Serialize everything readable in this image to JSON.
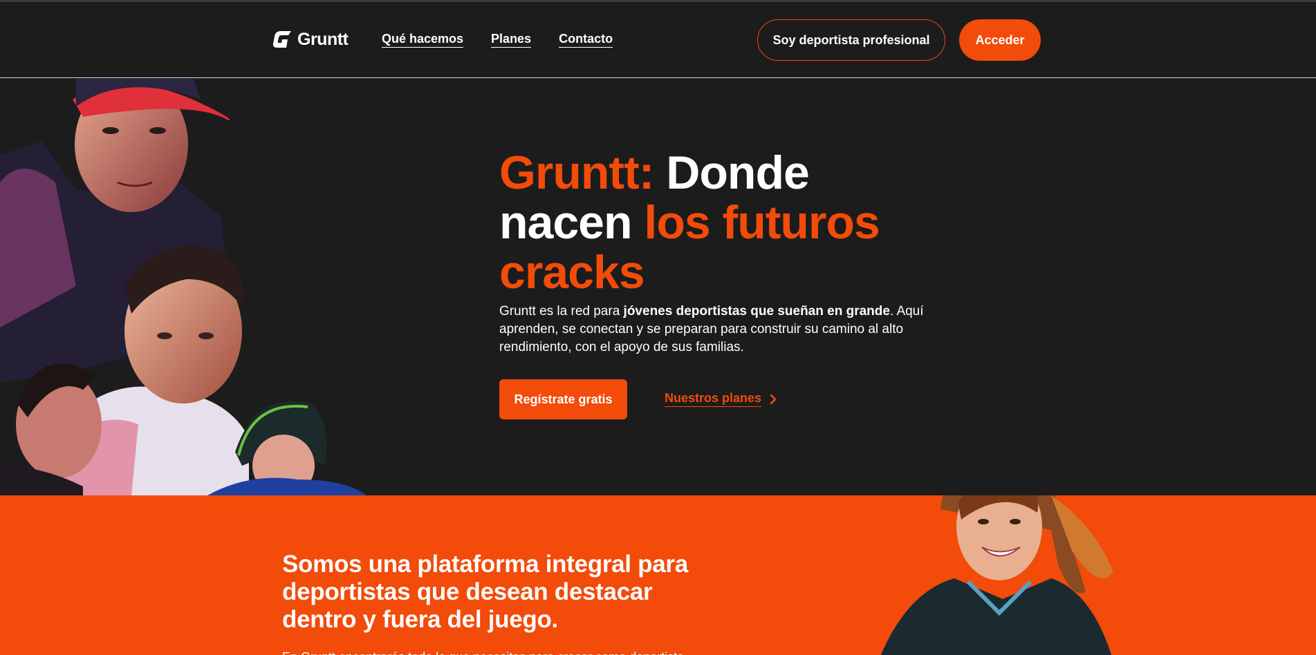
{
  "colors": {
    "accent": "#f24b0a",
    "background": "#1c1c1c",
    "text": "#ffffff"
  },
  "header": {
    "logo_icon": "gruntt-g-logo-icon",
    "logo_text": "Gruntt",
    "nav": [
      {
        "label": "Qué hacemos"
      },
      {
        "label": "Planes"
      },
      {
        "label": "Contacto"
      }
    ],
    "pro_button_label": "Soy deportista profesional",
    "login_button_label": "Acceder"
  },
  "hero": {
    "title_part1": "Gruntt:",
    "title_part2": " Donde nacen ",
    "title_part3": "los futuros cracks",
    "description_pre": "Gruntt es la red para ",
    "description_bold": "jóvenes deportistas que sueñan en grande",
    "description_post": ". Aquí aprenden, se conectan y se preparan para construir su camino al alto rendimiento, con el apoyo de sus familias.",
    "register_button_label": "Regístrate gratis",
    "plans_link_label": "Nuestros planes",
    "plans_link_icon": "chevron-right-icon",
    "image_description_icon": "athletes-collage-image"
  },
  "about": {
    "title": "Somos una plataforma integral para deportistas que desean destacar dentro y fuera del juego.",
    "text": "En Gruntt encontrarás todo lo que necesitas para crecer como deportista.",
    "image_icon": "smiling-athlete-image"
  }
}
